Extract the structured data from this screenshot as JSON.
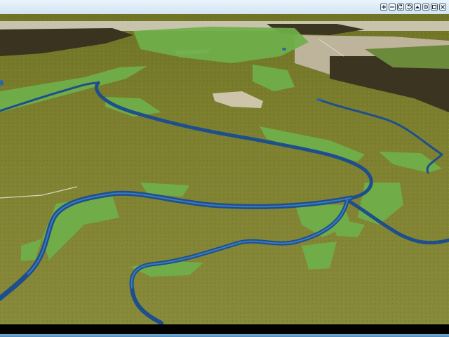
{
  "window": {
    "controls": [
      {
        "name": "zoom-in-icon"
      },
      {
        "name": "zoom-out-icon"
      },
      {
        "name": "rotate-left-icon"
      },
      {
        "name": "rotate-right-icon"
      },
      {
        "name": "tilt-icon"
      },
      {
        "name": "reset-view-icon"
      },
      {
        "name": "minimize-icon"
      },
      {
        "name": "close-icon"
      }
    ]
  },
  "scene": {
    "description_type": "3d-terrain-view",
    "colors": {
      "grass": "#7b7e2c",
      "grass_dark": "#5f6a22",
      "river": "#2a5f9a",
      "trees": "#6fb04a",
      "dark_field": "#3a3420",
      "bare_ground": "#c9c0a6"
    }
  }
}
